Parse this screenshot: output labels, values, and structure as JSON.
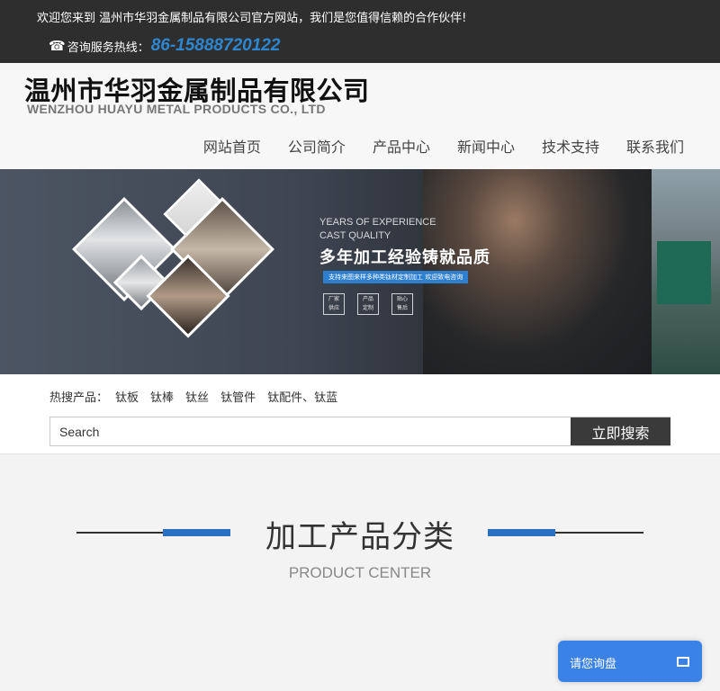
{
  "topbar": {
    "welcome": "欢迎您来到 温州市华羽金属制品有限公司官方网站，我们是您值得信赖的合作伙伴!",
    "hotline_label": "咨询服务热线：",
    "hotline_number": "86-15888720122",
    "phone_icon": "☎"
  },
  "header": {
    "logo_cn": "温州市华羽金属制品有限公司",
    "logo_en": "WENZHOU HUAYU METAL PRODUCTS CO., LTD"
  },
  "nav": {
    "items": [
      {
        "label": "网站首页"
      },
      {
        "label": "公司简介"
      },
      {
        "label": "产品中心"
      },
      {
        "label": "新闻中心"
      },
      {
        "label": "技术支持"
      },
      {
        "label": "联系我们"
      }
    ]
  },
  "banner": {
    "slogan_en_1": "YEARS OF EXPERIENCE",
    "slogan_en_2": "CAST QUALITY",
    "slogan_cn": "多年加工经验铸就品质",
    "tagline": "支持来图来样多种类钛材定制加工 欢迎致电咨询",
    "badges": [
      {
        "line1": "厂家",
        "line2": "供应"
      },
      {
        "line1": "产品",
        "line2": "定制"
      },
      {
        "line1": "贴心",
        "line2": "售后"
      }
    ]
  },
  "hot_search": {
    "label": "热搜产品：",
    "items": [
      "钛板",
      "钛棒",
      "钛丝",
      "钛管件",
      "钛配件、钛蓝"
    ]
  },
  "search": {
    "placeholder": "Search",
    "button_label": "立即搜索"
  },
  "section": {
    "title_cn": "加工产品分类",
    "title_en": "PRODUCT CENTER"
  },
  "chat": {
    "label": "请您询盘",
    "icon": "chat-window-icon"
  },
  "colors": {
    "topbar_bg": "#2e2e2e",
    "hotline_blue": "#2d87d0",
    "accent_blue": "#2a6fc0",
    "search_button_bg": "#3a3a3a",
    "chat_bg": "#3b82e6"
  }
}
